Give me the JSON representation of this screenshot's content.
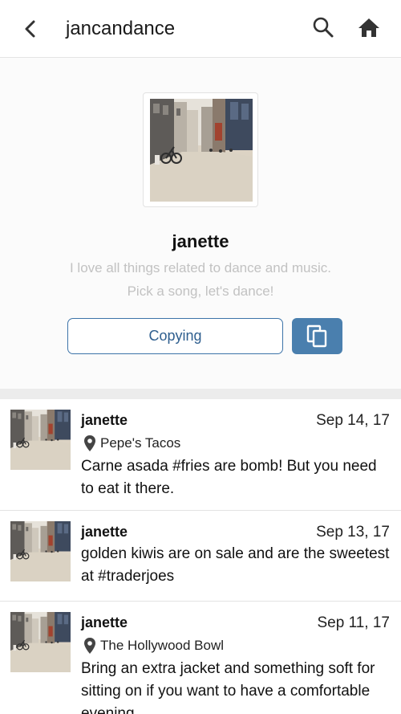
{
  "header": {
    "title": "jancandance"
  },
  "profile": {
    "name": "janette",
    "bio_line1": "I love all things related to dance and music.",
    "bio_line2": "Pick a song, let's dance!",
    "copying_label": "Copying"
  },
  "colors": {
    "accent": "#4a7fae",
    "accent_text": "#2f5f8f",
    "muted_text": "#c2c2c2",
    "divider": "#ececec"
  },
  "icons": [
    "back-arrow-icon",
    "search-icon",
    "home-icon",
    "copy-icon",
    "location-pin-icon"
  ],
  "posts": [
    {
      "user": "janette",
      "date": "Sep 14, 17",
      "location": "Pepe's Tacos",
      "text": "Carne asada #fries are bomb! But you need to eat it there."
    },
    {
      "user": "janette",
      "date": "Sep 13, 17",
      "text": "golden kiwis are on sale and are the sweetest at #traderjoes"
    },
    {
      "user": "janette",
      "date": "Sep 11, 17",
      "location": "The Hollywood Bowl",
      "text": "Bring an extra jacket and something soft for sitting on if you want to have a comfortable evening"
    }
  ]
}
